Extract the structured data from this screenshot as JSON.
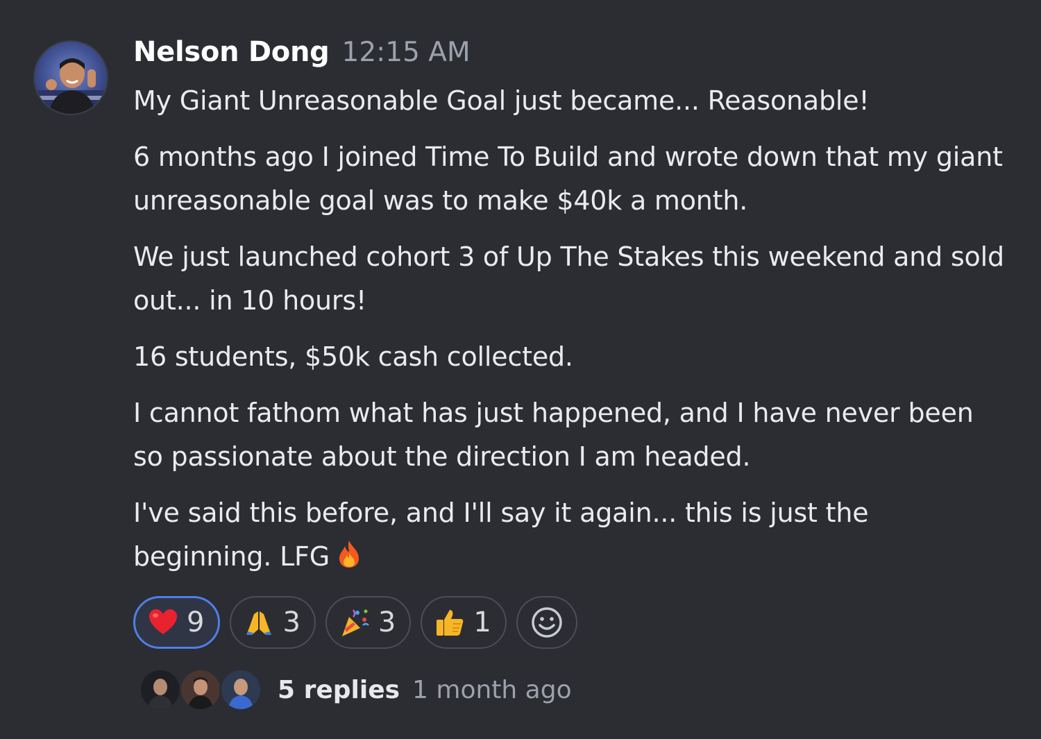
{
  "message": {
    "author": "Nelson Dong",
    "timestamp": "12:15 AM",
    "paragraphs": [
      "My Giant Unreasonable Goal just became... Reasonable!",
      "6 months ago I joined Time To Build and wrote down that my giant unreasonable goal was to make $40k a month.",
      "We just launched cohort 3 of Up The Stakes this weekend and sold out... in 10 hours!",
      "16 students, $50k cash collected.",
      "I cannot fathom what has just happened, and I have never been so passionate about the direction I am headed.",
      "I've said this before, and I'll say it again... this is just the beginning. LFG"
    ],
    "trailing_icon": "fire-icon"
  },
  "reactions": [
    {
      "icon": "red-heart-icon",
      "count": "9",
      "selected": true
    },
    {
      "icon": "folded-hands-icon",
      "count": "3",
      "selected": false
    },
    {
      "icon": "party-popper-icon",
      "count": "3",
      "selected": false
    },
    {
      "icon": "thumbs-up-icon",
      "count": "1",
      "selected": false
    }
  ],
  "add_reaction_icon": "smiley-add-reaction-icon",
  "thread": {
    "replies_label": "5 replies",
    "last_reply": "1 month ago"
  },
  "colors": {
    "background": "#2b2d33",
    "selected_border": "#4f7fe6",
    "muted_text": "#9da1ab"
  }
}
